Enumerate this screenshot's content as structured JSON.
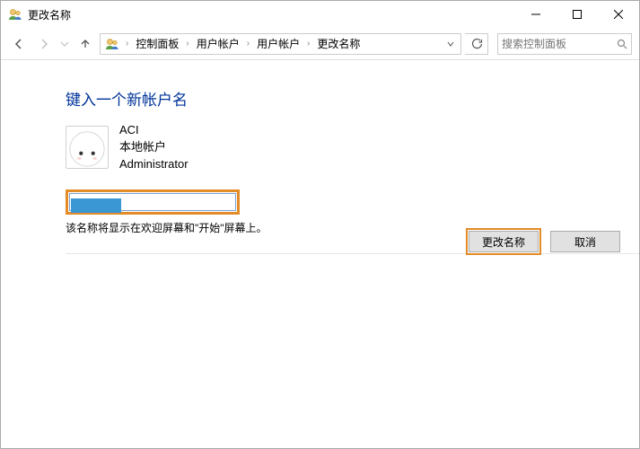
{
  "window": {
    "title": "更改名称"
  },
  "breadcrumb": {
    "root": "控制面板",
    "level1": "用户帐户",
    "level2": "用户帐户",
    "level3": "更改名称"
  },
  "search": {
    "placeholder": "搜索控制面板"
  },
  "page": {
    "heading": "键入一个新帐户名",
    "account_name": "ACI",
    "account_type": "本地帐户",
    "account_role": "Administrator",
    "input_value": "",
    "hint": "该名称将显示在欢迎屏幕和\"开始\"屏幕上。"
  },
  "buttons": {
    "primary": "更改名称",
    "cancel": "取消"
  }
}
